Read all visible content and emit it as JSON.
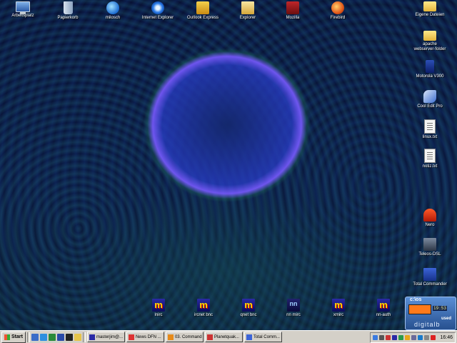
{
  "desktop": {
    "top_icons": [
      {
        "label": "Arbeitsplatz",
        "glyph": "my-computer-icon"
      },
      {
        "label": "Papierkorb",
        "glyph": "recycle-bin-icon"
      },
      {
        "label": "milosch",
        "glyph": "network-icon"
      },
      {
        "label": "Internet Explorer",
        "glyph": "internet-explorer-icon"
      },
      {
        "label": "Outlook Express",
        "glyph": "outlook-express-icon"
      },
      {
        "label": "Explorer",
        "glyph": "explorer-icon"
      },
      {
        "label": "Mozilla",
        "glyph": "mozilla-icon"
      },
      {
        "label": "Firebird",
        "glyph": "firebird-icon"
      }
    ],
    "right_icons": [
      {
        "label": "Eigene Dateien",
        "glyph": "my-documents-icon"
      },
      {
        "label": "apache",
        "label2": "webserver-folder",
        "glyph": "folder-icon"
      },
      {
        "label": "Motorola V300",
        "glyph": "phone-icon"
      },
      {
        "label": "Cool Edit Pro",
        "glyph": "cool-edit-icon"
      },
      {
        "label": "linux.txt",
        "glyph": "text-file-icon"
      },
      {
        "label": "notiz.txt",
        "glyph": "text-file-icon"
      },
      {
        "label": "Nero",
        "glyph": "nero-icon"
      },
      {
        "label": "Teleos-DSL",
        "glyph": "dsl-icon"
      },
      {
        "label": "Total Commander",
        "glyph": "total-commander-icon"
      }
    ],
    "bottom_icons": [
      {
        "label": "lnirc",
        "glyph": "mirc-icon"
      },
      {
        "label": "ircnet bnc",
        "glyph": "mirc-icon"
      },
      {
        "label": "qnet bnc",
        "glyph": "mirc-icon"
      },
      {
        "label": "nn mirc",
        "glyph": "nnmirc-icon"
      },
      {
        "label": "xmirc",
        "glyph": "mirc-icon"
      },
      {
        "label": "nn-auth",
        "glyph": "mirc-icon"
      }
    ],
    "widget": {
      "title": "c:\\os",
      "clock": "19:53",
      "used": "used"
    },
    "brand": "digitalb"
  },
  "taskbar": {
    "start_label": "Start",
    "buttons": [
      {
        "label": "masterjim@...",
        "glyph": "mirc-icon"
      },
      {
        "label": "News DFN ...",
        "glyph": "news-icon"
      },
      {
        "label": "03. Command",
        "glyph": "media-icon"
      },
      {
        "label": "Planetquak...",
        "glyph": "browser-icon"
      },
      {
        "label": "Total Comm...",
        "glyph": "total-commander-icon"
      }
    ],
    "clock": "16:46"
  }
}
